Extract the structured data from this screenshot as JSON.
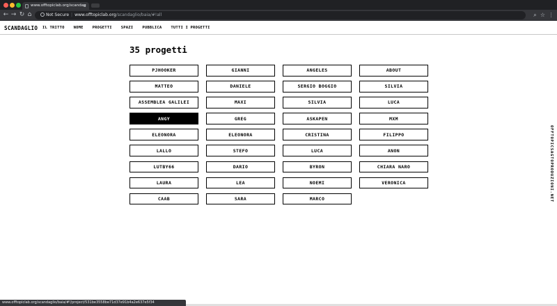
{
  "browser": {
    "tab_title": "www.offtopiclab.org/scandag",
    "tab_close": "×",
    "url_security": "Not Secure",
    "url_host": "www.offtopiclab.org",
    "url_path": "/scandaglio/baia/#!all",
    "nav_icons": [
      "back-icon",
      "forward-icon",
      "reload-icon",
      "home-icon"
    ],
    "status_url": "www.offtopiclab.org/scandaglio/baia/#!/project/531be3558be71d37e91b4a2e637e5f34"
  },
  "site": {
    "logo": "SCANDAGLIO",
    "nav": [
      "IL TRITTO",
      "NOME",
      "PROGETTI",
      "SPAZI",
      "PUBBLICA",
      "TUTTI I PROGETTI"
    ],
    "count_title": "35 progetti",
    "side_text": "OFFTOPICSAGTOPRODUZIONI.NET",
    "projects": [
      [
        "PJHOOKER",
        "GIANNI",
        "ANGELES",
        "ABOUT"
      ],
      [
        "MATTEO",
        "DANIELE",
        "SERGIO BOGGIO",
        "SILVIA"
      ],
      [
        "ASSEMBLEA GALILEI",
        "MAXI",
        "SILVIA",
        "LUCA"
      ],
      [
        "ANGY",
        "GREG",
        "ASKAPEN",
        "MXM"
      ],
      [
        "ELEONORA",
        "ELEONORA",
        "CRISTINA",
        "FILIPPO"
      ],
      [
        "LALLO",
        "STEFO",
        "LUCA",
        "ANON"
      ],
      [
        "LUTBY66",
        "DARIO",
        "BYRON",
        "CHIARA NARO"
      ],
      [
        "LAURA",
        "LEA",
        "NOEMI",
        "VERONICA"
      ],
      [
        "CAAB",
        "SARA",
        "MARCO",
        ""
      ]
    ],
    "active_project": "ANGY",
    "colors": {
      "active_bg": "#000000",
      "active_fg": "#ffffff",
      "border": "#000000"
    }
  }
}
